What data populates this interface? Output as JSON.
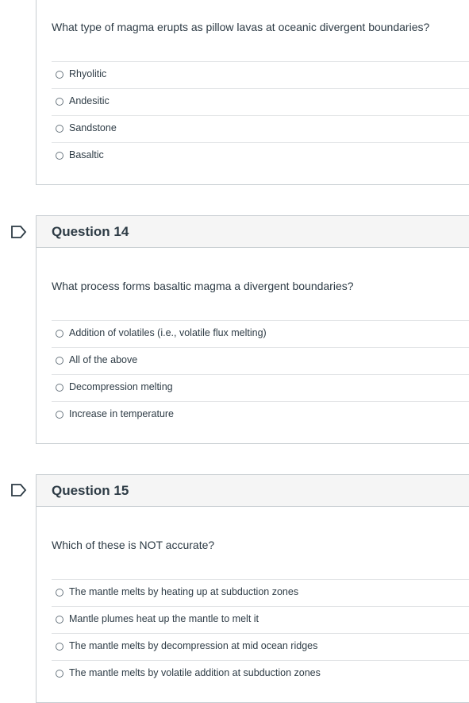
{
  "questions": [
    {
      "title": "",
      "text": "What type of magma erupts as pillow lavas at oceanic divergent boundaries?",
      "answers": [
        "Rhyolitic",
        "Andesitic",
        "Sandstone",
        "Basaltic"
      ]
    },
    {
      "title": "Question 14",
      "text": "What process forms basaltic magma a divergent boundaries?",
      "answers": [
        "Addition of volatiles (i.e., volatile flux melting)",
        "All of the above",
        "Decompression melting",
        "Increase in temperature"
      ]
    },
    {
      "title": "Question 15",
      "text": "Which of these is NOT accurate?",
      "answers": [
        "The mantle melts by heating up at subduction zones",
        "Mantle plumes heat up the mantle to melt it",
        "The mantle melts by decompression at mid ocean ridges",
        "The mantle melts by volatile addition at subduction zones"
      ]
    }
  ],
  "icons": {
    "flag": "flag-question-icon"
  },
  "colors": {
    "border": "#c7cdd1",
    "header_bg": "#f5f5f5",
    "text": "#2d3b45"
  }
}
